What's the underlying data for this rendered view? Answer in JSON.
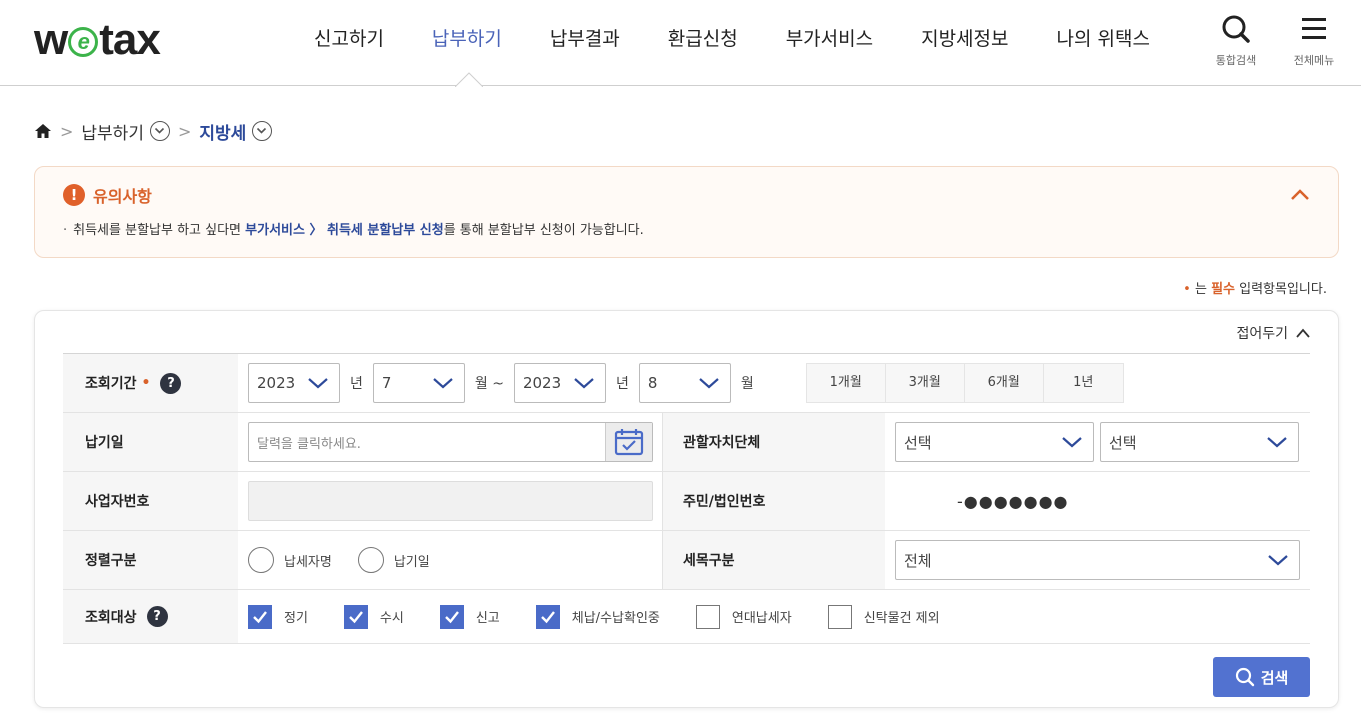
{
  "logo": {
    "pre": "w",
    "mark": "e",
    "post": "tax"
  },
  "nav": [
    {
      "label": "신고하기",
      "active": false
    },
    {
      "label": "납부하기",
      "active": true
    },
    {
      "label": "납부결과",
      "active": false
    },
    {
      "label": "환급신청",
      "active": false
    },
    {
      "label": "부가서비스",
      "active": false
    },
    {
      "label": "지방세정보",
      "active": false
    },
    {
      "label": "나의 위택스",
      "active": false
    }
  ],
  "utility": {
    "search_label": "통합검색",
    "menu_label": "전체메뉴"
  },
  "colors": {
    "accent": "#4a63b8",
    "notice": "#d9622b",
    "checked": "#4a6bc8",
    "button": "#5272d0"
  },
  "breadcrumb": {
    "level1": "납부하기",
    "level2": "지방세"
  },
  "notice": {
    "title": "유의사항",
    "prefix": "취득세를 분할납부 하고 싶다면 ",
    "link": "부가서비스 〉 취득세 분할납부 신청",
    "suffix": "를 통해 분할납부 신청이 가능합니다."
  },
  "required_note": {
    "mark": "•",
    "pre": " 는 ",
    "strong": "필수",
    "post": " 입력항목입니다."
  },
  "form": {
    "collapse_label": "접어두기",
    "period": {
      "label": "조회기간",
      "from_year": "2023",
      "from_month": "7",
      "to_year": "2023",
      "to_month": "8",
      "year_unit": "년",
      "month_unit_tilde": "월 ~",
      "month_unit": "월",
      "quick": [
        "1개월",
        "3개월",
        "6개월",
        "1년"
      ]
    },
    "pay_date": {
      "label": "납기일",
      "placeholder": "달력을 클릭하세요."
    },
    "region": {
      "label": "관할자치단체",
      "sido": "선택",
      "sigungu": "선택"
    },
    "biz_no": {
      "label": "사업자번호",
      "value": ""
    },
    "resident_no": {
      "label": "주민/법인번호",
      "masked": "-●●●●●●●"
    },
    "sort": {
      "label": "정렬구분",
      "options": [
        "납세자명",
        "납기일"
      ]
    },
    "tax_type": {
      "label": "세목구분",
      "value": "전체"
    },
    "target": {
      "label": "조회대상",
      "items": [
        {
          "label": "정기",
          "checked": true
        },
        {
          "label": "수시",
          "checked": true
        },
        {
          "label": "신고",
          "checked": true
        },
        {
          "label": "체납/수납확인중",
          "checked": true
        },
        {
          "label": "연대납세자",
          "checked": false
        },
        {
          "label": "신탁물건 제외",
          "checked": false
        }
      ]
    },
    "search_button": "검색"
  }
}
